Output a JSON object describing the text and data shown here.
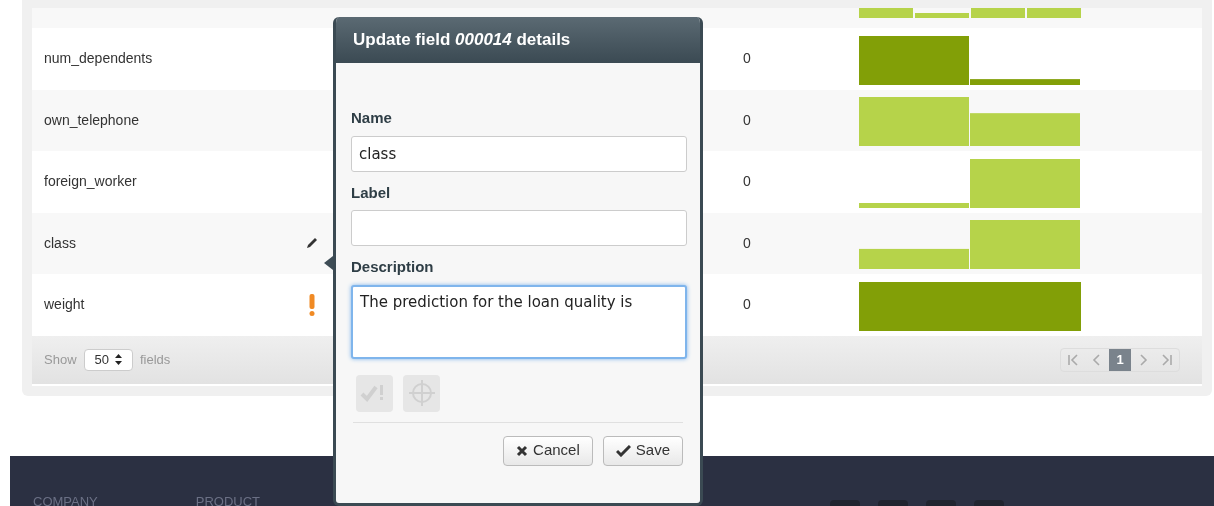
{
  "table": {
    "rows": [
      {
        "name": "num_dependents",
        "missing": "0",
        "kind": "plain",
        "color": "#829f07"
      },
      {
        "name": "own_telephone",
        "missing": "0",
        "kind": "plain",
        "color": "#b6d34a"
      },
      {
        "name": "foreign_worker",
        "missing": "0",
        "kind": "plain",
        "color": "#b6d34a"
      },
      {
        "name": "class",
        "missing": "0",
        "kind": "editing",
        "color": "#b6d34a"
      },
      {
        "name": "weight",
        "missing": "0",
        "kind": "flagged",
        "color": "#829f07"
      }
    ],
    "footer": {
      "show": "Show",
      "page_size": "50",
      "fields": "fields"
    },
    "pagination": [
      {
        "kind": "first",
        "selected": false
      },
      {
        "kind": "prev",
        "selected": false
      },
      {
        "kind": "page",
        "label": "1",
        "selected": true
      },
      {
        "kind": "next",
        "selected": false
      },
      {
        "kind": "last",
        "selected": false
      }
    ]
  },
  "dialog": {
    "title": "Update field *000014* details",
    "fields": [
      {
        "label": "Name",
        "value": "class",
        "kind": "input",
        "focused": false
      },
      {
        "label": "Label",
        "kind": "input",
        "focused": false
      },
      {
        "label": "Description",
        "value": "The prediction for the loan quality is ",
        "kind": "textarea",
        "focused": true
      }
    ],
    "tools": [
      {
        "kind": "check",
        "disabled": true
      },
      {
        "kind": "target",
        "disabled": true
      }
    ],
    "buttons": [
      {
        "kind": "cancel",
        "label": "Cancel"
      },
      {
        "kind": "save",
        "label": "Save"
      }
    ]
  },
  "site_footer": {
    "columns": [
      "COMPANY",
      "PRODUCT"
    ]
  }
}
